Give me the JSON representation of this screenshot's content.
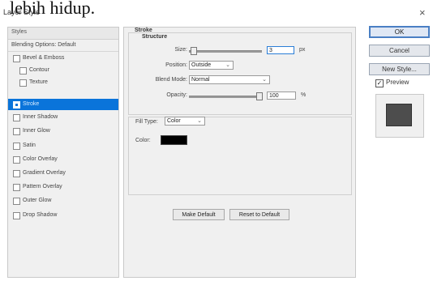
{
  "caption": "lebih hidup.",
  "window": {
    "title": "Layer Style",
    "close": "×"
  },
  "styles_list": {
    "header": "Styles",
    "blending": "Blending Options: Default",
    "items": [
      {
        "label": "Bevel & Emboss",
        "checked": false
      },
      {
        "label": "Contour",
        "checked": false
      },
      {
        "label": "Texture",
        "checked": false
      },
      {
        "label": "Stroke",
        "checked": true
      },
      {
        "label": "Inner Shadow",
        "checked": false
      },
      {
        "label": "Inner Glow",
        "checked": false
      },
      {
        "label": "Satin",
        "checked": false
      },
      {
        "label": "Color Overlay",
        "checked": false
      },
      {
        "label": "Gradient Overlay",
        "checked": false
      },
      {
        "label": "Pattern Overlay",
        "checked": false
      },
      {
        "label": "Outer Glow",
        "checked": false
      },
      {
        "label": "Drop Shadow",
        "checked": false
      }
    ]
  },
  "stroke": {
    "title": "Stroke",
    "structure_title": "Structure",
    "size_label": "Size:",
    "size_value": "3",
    "size_unit": "px",
    "position_label": "Position:",
    "position_value": "Outside",
    "blend_mode_label": "Blend Mode:",
    "blend_mode_value": "Normal",
    "opacity_label": "Opacity:",
    "opacity_value": "100",
    "opacity_unit": "%",
    "fill_type_label": "Fill Type:",
    "fill_type_value": "Color",
    "color_label": "Color:",
    "color_value": "#000000"
  },
  "buttons": {
    "make_default": "Make Default",
    "reset_default": "Reset to Default",
    "ok": "OK",
    "cancel": "Cancel",
    "new_style": "New Style...",
    "preview": "Preview"
  },
  "preview_swatch_color": "#4d4d4d"
}
